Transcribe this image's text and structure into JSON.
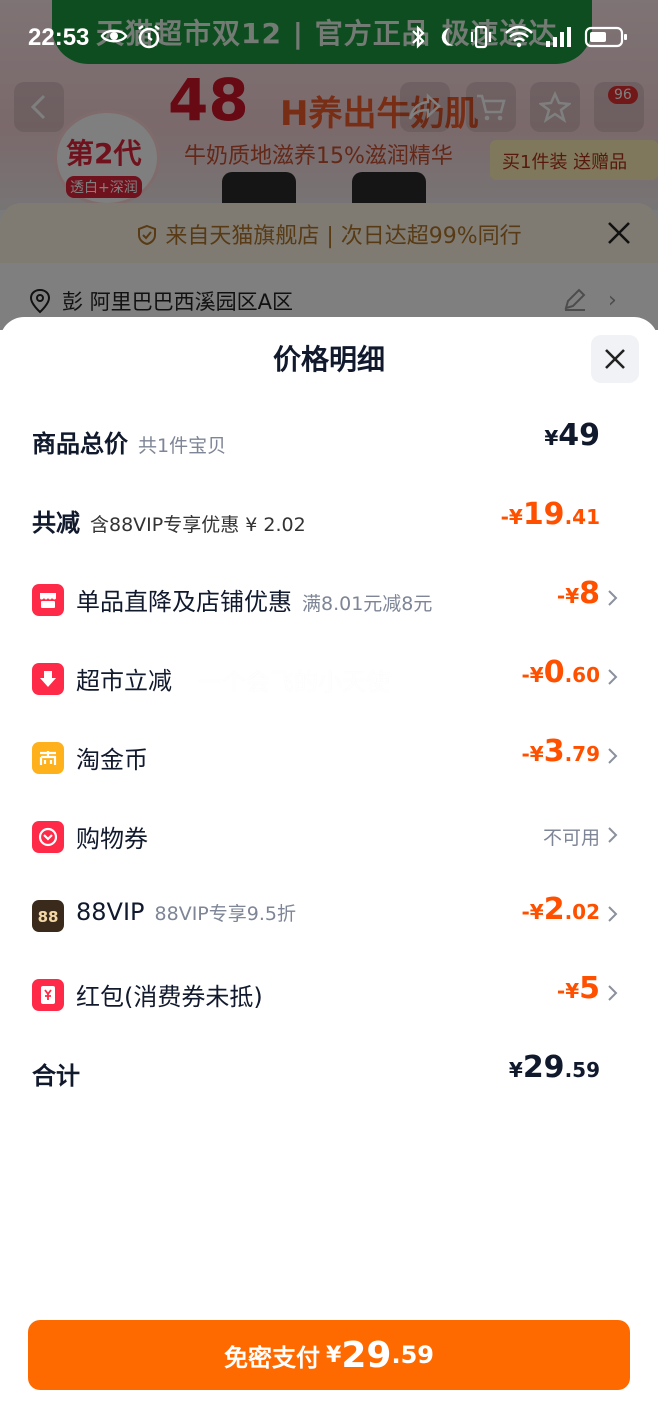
{
  "status_bar": {
    "time": "22:53"
  },
  "background": {
    "banner_text": "天猫超市双12 | 官方正品 极速送达",
    "headline_num": "48",
    "headline_rest": "H养出牛奶肌",
    "subline": "牛奶质地滋养15%滋润精华",
    "badge_line1": "第2代",
    "badge_line2": "透白+深润",
    "gift_text": "买1件装 送赠品",
    "cart_count": "96",
    "notice": "来自天猫旗舰店 | 次日达超99%同行",
    "address": "彭 阿里巴巴西溪园区A区"
  },
  "sheet": {
    "title": "价格明细"
  },
  "rows": {
    "total_price": {
      "label": "商品总价",
      "sub": "共1件宝贝",
      "sym": "¥",
      "big": "49",
      "small": ""
    },
    "total_discount": {
      "label": "共减",
      "sub": "含88VIP专享优惠 ¥ 2.02",
      "sym": "-¥",
      "big": "19",
      "small": ".41"
    },
    "item_discount": {
      "label": "单品直降及店铺优惠",
      "sub": "满8.01元减8元",
      "sym": "-¥",
      "big": "8",
      "small": ""
    },
    "market_discount": {
      "label": "超市立减",
      "sym": "-¥",
      "big": "0",
      "small": ".60"
    },
    "tao_coin": {
      "label": "淘金币",
      "sym": "-¥",
      "big": "3",
      "small": ".79"
    },
    "coupon": {
      "label": "购物券",
      "status": "不可用"
    },
    "vip88": {
      "label": "88VIP",
      "sub": "88VIP专享9.5折",
      "sym": "-¥",
      "big": "2",
      "small": ".02"
    },
    "red_packet": {
      "label": "红包(消费券未抵)",
      "sym": "-¥",
      "big": "5",
      "small": ""
    },
    "sum": {
      "label": "合计",
      "sym": "¥",
      "big": "29",
      "small": ".59"
    }
  },
  "watermark": "一个会飞的小天使",
  "pay_button": {
    "label": "免密支付",
    "sym": "¥",
    "big": "29",
    "small": ".59"
  },
  "colors": {
    "accent": "#ff5000",
    "pay_button": "#ff6a00",
    "text": "#11192d",
    "muted": "#7d8596"
  },
  "icons": {
    "item_discount": "shop-icon",
    "market_discount": "down-arrow-icon",
    "tao_coin": "coin-icon",
    "coupon": "coupon-icon",
    "vip88": "vip88-icon",
    "red_packet": "red-packet-icon"
  }
}
